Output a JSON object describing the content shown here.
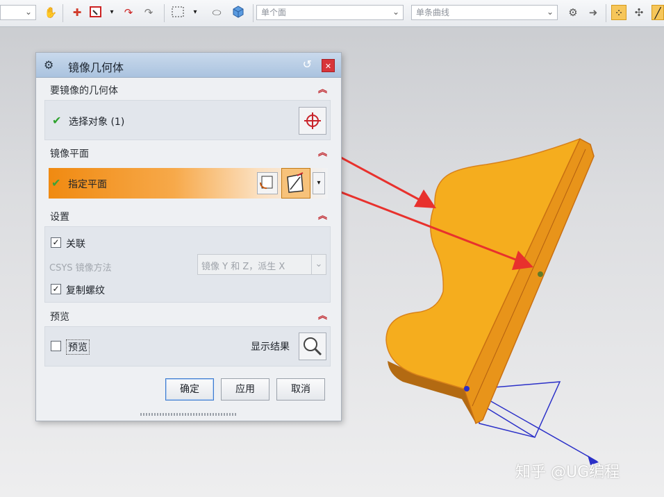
{
  "toolbar": {
    "filter_combo_1": "单个面",
    "filter_combo_2": "单条曲线",
    "icons": [
      "snap-icon",
      "select-icon",
      "box-select-icon",
      "rotate-icon",
      "cube-icon",
      "settings-icon",
      "arrow-right-icon",
      "grid-snap-icon"
    ]
  },
  "dialog": {
    "title": "镜像几何体",
    "section_geometry": {
      "label": "要镜像的几何体",
      "row_label": "选择对象 (1)"
    },
    "section_plane": {
      "label": "镜像平面",
      "row_label": "指定平面"
    },
    "section_settings": {
      "label": "设置",
      "associative_label": "关联",
      "associative_checked": true,
      "csys_label": "CSYS 镜像方法",
      "csys_value": "镜像 Y 和 Z，派生 X",
      "copy_threads_label": "复制螺纹",
      "copy_threads_checked": true
    },
    "section_preview": {
      "label": "预览",
      "preview_label": "预览",
      "preview_checked": false,
      "show_result_label": "显示结果"
    },
    "buttons": {
      "ok": "确定",
      "apply": "应用",
      "cancel": "取消"
    }
  },
  "watermark": "知乎 @UG编程",
  "colors": {
    "part_fill": "#f5ad1e",
    "part_edge": "#d9821a",
    "annotation_arrow": "#e8312d",
    "highlight_orange": "#f08a11",
    "csys_blue": "#2b30c8"
  }
}
